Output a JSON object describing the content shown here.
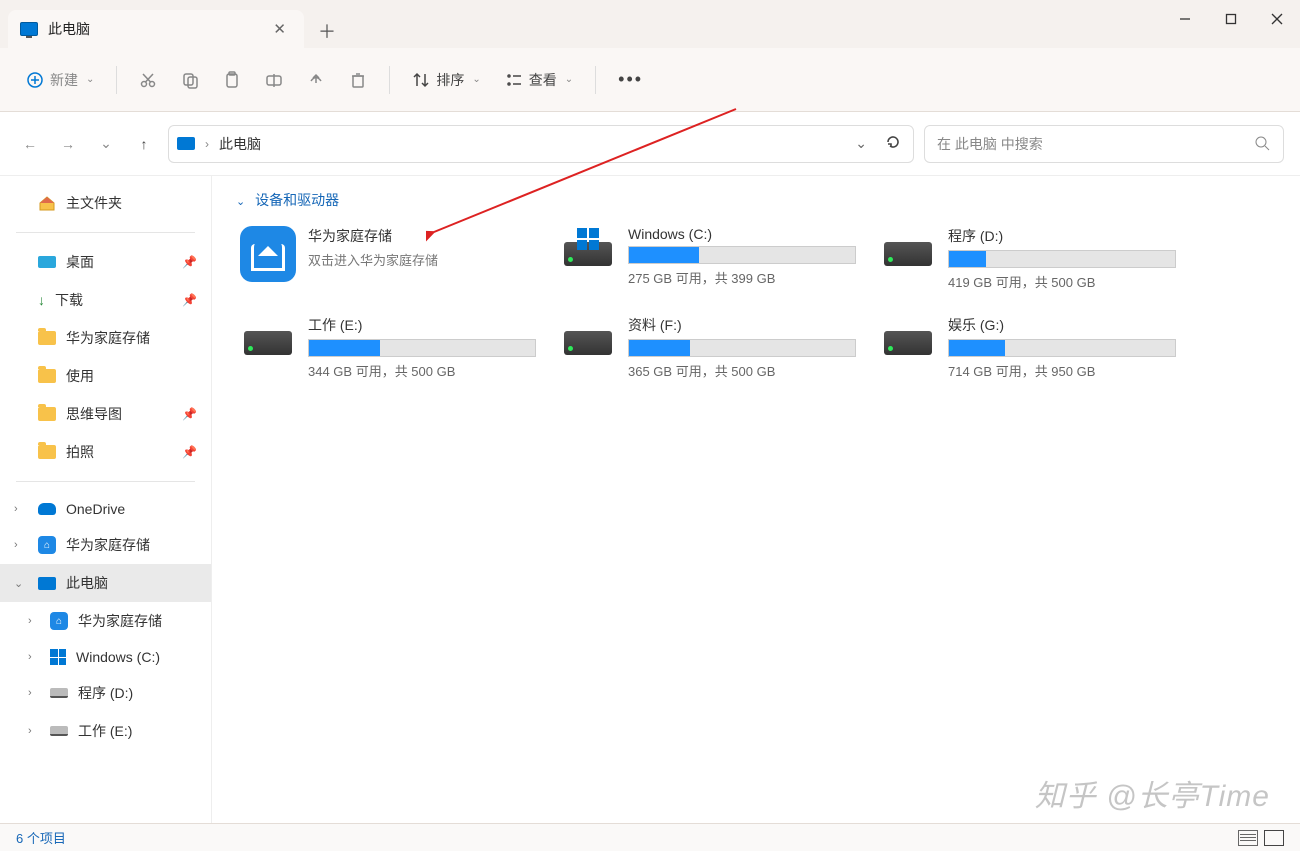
{
  "window": {
    "tab_title": "此电脑"
  },
  "toolbar": {
    "new_label": "新建",
    "sort_label": "排序",
    "view_label": "查看"
  },
  "address": {
    "crumb": "此电脑"
  },
  "search": {
    "placeholder": "在 此电脑 中搜索"
  },
  "sidebar": {
    "home": "主文件夹",
    "quick": [
      {
        "label": "桌面",
        "icon": "desktop",
        "pinned": true
      },
      {
        "label": "下载",
        "icon": "download",
        "pinned": true
      },
      {
        "label": "华为家庭存储",
        "icon": "folder",
        "pinned": false
      },
      {
        "label": "使用",
        "icon": "folder",
        "pinned": false
      },
      {
        "label": "思维导图",
        "icon": "folder",
        "pinned": true
      },
      {
        "label": "拍照",
        "icon": "folder",
        "pinned": true
      }
    ],
    "cloud": [
      {
        "label": "OneDrive",
        "icon": "onedrive",
        "exp": "›"
      },
      {
        "label": "华为家庭存储",
        "icon": "huawei",
        "exp": "›"
      }
    ],
    "pc": {
      "label": "此电脑",
      "children": [
        {
          "label": "华为家庭存储",
          "icon": "huawei",
          "exp": "›"
        },
        {
          "label": "Windows (C:)",
          "icon": "win",
          "exp": "›"
        },
        {
          "label": "程序 (D:)",
          "icon": "disk",
          "exp": "›"
        },
        {
          "label": "工作 (E:)",
          "icon": "disk",
          "exp": "›"
        }
      ]
    }
  },
  "content": {
    "section_header": "设备和驱动器",
    "huawei": {
      "name": "华为家庭存储",
      "sub": "双击进入华为家庭存储"
    },
    "drives": [
      {
        "name": "Windows (C:)",
        "free": 275,
        "total": 399,
        "space_text": "275 GB 可用，共 399 GB",
        "win": true
      },
      {
        "name": "程序 (D:)",
        "free": 419,
        "total": 500,
        "space_text": "419 GB 可用，共 500 GB"
      },
      {
        "name": "工作 (E:)",
        "free": 344,
        "total": 500,
        "space_text": "344 GB 可用，共 500 GB"
      },
      {
        "name": "资料 (F:)",
        "free": 365,
        "total": 500,
        "space_text": "365 GB 可用，共 500 GB"
      },
      {
        "name": "娱乐 (G:)",
        "free": 714,
        "total": 950,
        "space_text": "714 GB 可用，共 950 GB"
      }
    ]
  },
  "status": {
    "items_text": "6 个项目"
  },
  "watermark": "知乎 @长亭Time"
}
